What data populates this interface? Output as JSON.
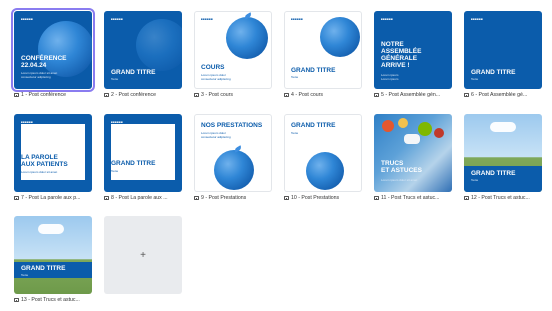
{
  "cards": [
    {
      "label": "1 - Post conférence",
      "heading": "CONFÉRENCE\n22.04.24",
      "sub": "Lorem ipsum dolor sit amet\nconsectetur adipiscing"
    },
    {
      "label": "2 - Post conférence",
      "heading": "GRAND TITRE",
      "sub": "Texte"
    },
    {
      "label": "3 - Post cours",
      "heading": "COURS",
      "sub": "Lorem ipsum dolor\nconsectetur adipiscing"
    },
    {
      "label": "4 - Post cours",
      "heading": "GRAND TITRE",
      "sub": "Texte"
    },
    {
      "label": "5 - Post Assemblée gén...",
      "heading": "NOTRE\nASSEMBLÉE\nGÉNÉRALE\nARRIVE !",
      "sub": "Lorem ipsum\nLorem ipsum"
    },
    {
      "label": "6 - Post Assemblée gé...",
      "heading": "GRAND TITRE",
      "sub": "Texte"
    },
    {
      "label": "7 - Post La parole aux p...",
      "heading": "LA PAROLE\nAUX PATIENTS",
      "sub": "Lorem ipsum dolor sit amet"
    },
    {
      "label": "8 - Post La parole aux ...",
      "heading": "GRAND TITRE",
      "sub": "Texte"
    },
    {
      "label": "9 - Post Prestations",
      "heading": "NOS PRESTATIONS",
      "sub": "Lorem ipsum dolor\nconsectetur adipiscing"
    },
    {
      "label": "10 - Post Prestations",
      "heading": "GRAND TITRE",
      "sub": "Texte"
    },
    {
      "label": "11 - Post Trucs et astuc...",
      "heading": "TRUCS\nET ASTUCES",
      "sub": "Lorem ipsum dolor sit amet"
    },
    {
      "label": "12 - Post Trucs et astuc...",
      "heading": "GRAND TITRE",
      "sub": "Texte"
    },
    {
      "label": "13 - Post Trucs et astuc...",
      "heading": "GRAND TITRE",
      "sub": "Texte"
    }
  ],
  "add_card": {
    "icon": "+"
  },
  "colors": {
    "brand_blue": "#0b5cab",
    "selection": "#8a7cf0",
    "add_bg": "#e9ebee"
  }
}
